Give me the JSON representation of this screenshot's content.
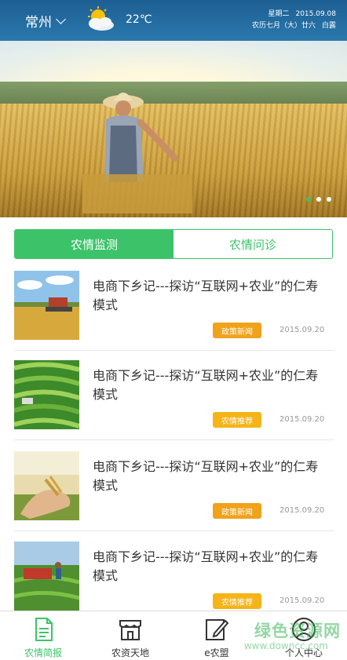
{
  "header": {
    "city": "常州",
    "temperature": "22℃",
    "weekday": "星期二",
    "date": "2015.09.08",
    "lunar": "农历七月（大）廿六",
    "solar_term": "白露"
  },
  "banner": {
    "dots": 3,
    "active_dot": 1
  },
  "tabs": [
    {
      "label": "农情监测",
      "active": true
    },
    {
      "label": "农情问诊",
      "active": false
    }
  ],
  "news": [
    {
      "title": "电商下乡记---探访“互联网+农业”的仁寿模式",
      "badge": "政策新闻",
      "badge_color": "#f0a21b",
      "date": "2015.09.20",
      "image": "harvester-field"
    },
    {
      "title": "电商下乡记---探访“互联网+农业”的仁寿模式",
      "badge": "农情推荐",
      "badge_color": "#f5b417",
      "date": "2015.09.20",
      "image": "rice-terraces"
    },
    {
      "title": "电商下乡记---探访“互联网+农业”的仁寿模式",
      "badge": "政策新闻",
      "badge_color": "#f0a21b",
      "date": "2015.09.20",
      "image": "wheat-in-hands"
    },
    {
      "title": "电商下乡记---探访“互联网+农业”的仁寿模式",
      "badge": "农情推荐",
      "badge_color": "#f5b417",
      "date": "2015.09.20",
      "image": "farm-workers"
    }
  ],
  "bottom_nav": [
    {
      "label": "农情简报",
      "icon": "document-icon",
      "active": true
    },
    {
      "label": "农资天地",
      "icon": "store-icon",
      "active": false
    },
    {
      "label": "e农盟",
      "icon": "edit-icon",
      "active": false
    },
    {
      "label": "个人中心",
      "icon": "user-icon",
      "active": false
    }
  ],
  "watermark": {
    "main": "绿色资源网",
    "sub": "www.downcc.com"
  },
  "colors": {
    "accent": "#3cc36a",
    "header": "#2a78ad"
  }
}
